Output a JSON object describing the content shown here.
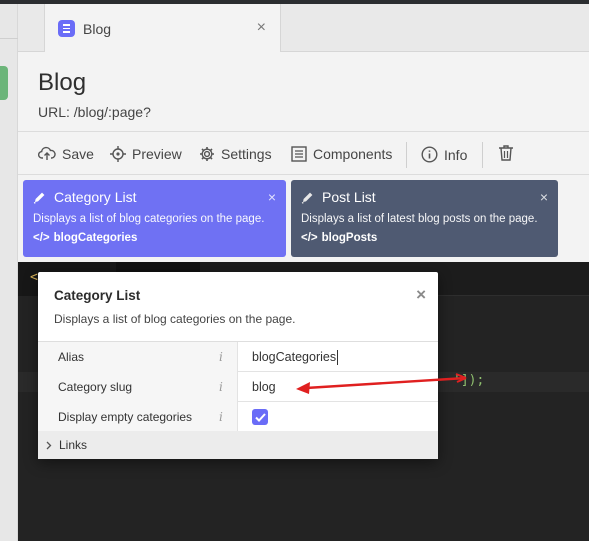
{
  "tab": {
    "label": "Blog",
    "close": "×"
  },
  "header": {
    "title": "Blog",
    "url": "URL: /blog/:page?"
  },
  "toolbar": {
    "save": "Save",
    "preview": "Preview",
    "settings": "Settings",
    "components": "Components",
    "info": "Info"
  },
  "components": [
    {
      "title": "Category List",
      "description": "Displays a list of blog categories on the page.",
      "alias": "blogCategories",
      "active": true
    },
    {
      "title": "Post List",
      "description": "Displays a list of latest blog posts on the page.",
      "alias": "blogPosts",
      "active": false
    }
  ],
  "editor": {
    "open_bracket": "<",
    "code_tail": "']);"
  },
  "popup": {
    "title": "Category List",
    "description": "Displays a list of blog categories on the page.",
    "close": "×",
    "properties": [
      {
        "name": "Alias",
        "value": "blogCategories"
      },
      {
        "name": "Category slug",
        "value": "blog"
      },
      {
        "name": "Display empty categories",
        "checked": true
      }
    ],
    "info_glyph": "i",
    "links_label": "Links"
  },
  "colors": {
    "accent": "#6a6cf7",
    "active_card": "#6f71f3",
    "inactive_card": "#4f5a72",
    "annotation_arrow": "#e02020"
  }
}
